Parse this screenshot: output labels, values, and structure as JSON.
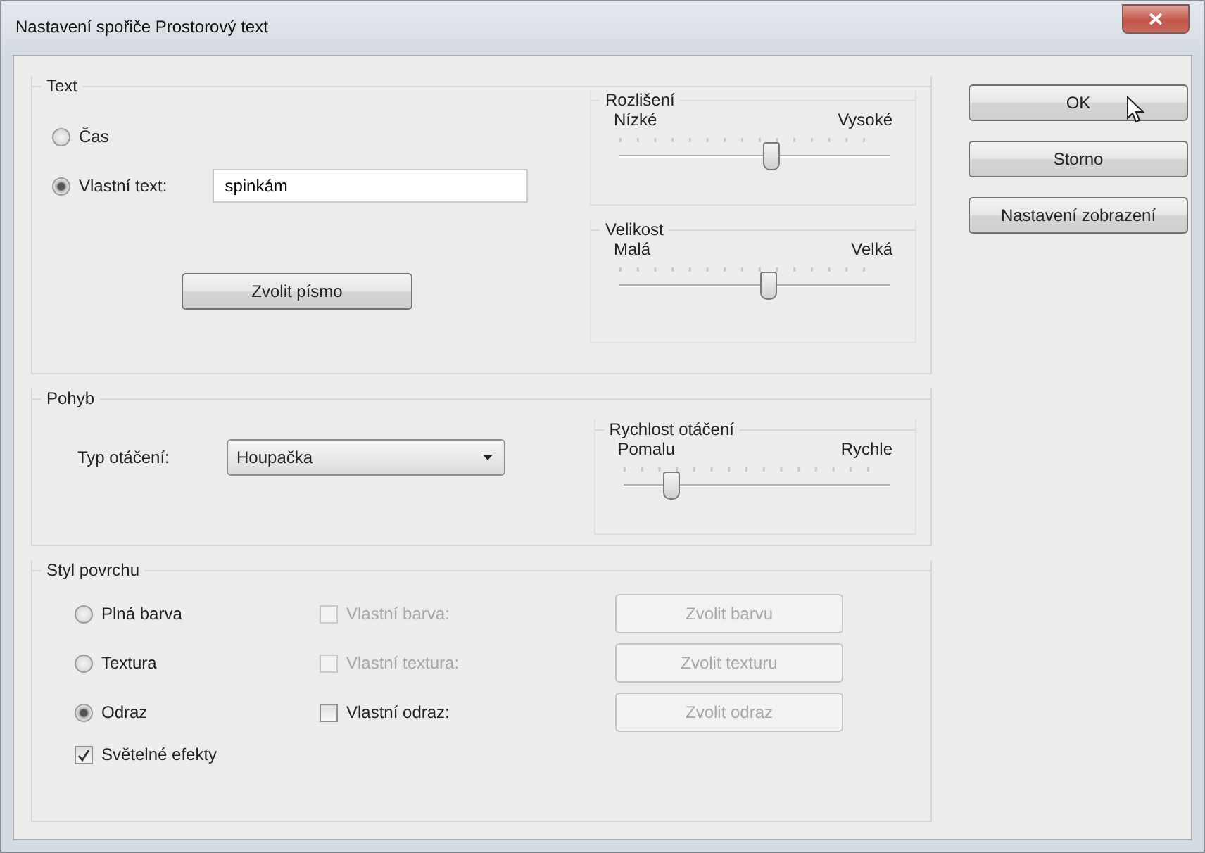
{
  "window": {
    "title": "Nastavení spořiče Prostorový text"
  },
  "text_group": {
    "title": "Text",
    "options": [
      {
        "label": "Čas",
        "selected": false
      },
      {
        "label": "Vlastní text:",
        "selected": true
      }
    ],
    "custom_text": {
      "value": "spinkám"
    },
    "font_button": "Zvolit písmo",
    "sliders": [
      {
        "title": "Rozlišení",
        "min_label": "Nízké",
        "max_label": "Vysoké",
        "level": 0.56
      },
      {
        "title": "Velikost",
        "min_label": "Malá",
        "max_label": "Velká",
        "level": 0.55
      }
    ]
  },
  "motion_group": {
    "title": "Pohyb",
    "rotation_label": "Typ otáčení:",
    "rotation_value": "Houpačka",
    "slider": {
      "title": "Rychlost otáčení",
      "min_label": "Pomalu",
      "max_label": "Rychle",
      "level": 0.18
    }
  },
  "surface_group": {
    "title": "Styl povrchu",
    "rows": [
      {
        "option": {
          "label": "Plná barva",
          "selected": false
        },
        "custom": {
          "label": "Vlastní barva:",
          "checked": false,
          "disabled": true
        },
        "button": {
          "label": "Zvolit barvu",
          "disabled": true
        }
      },
      {
        "option": {
          "label": "Textura",
          "selected": false
        },
        "custom": {
          "label": "Vlastní textura:",
          "checked": false,
          "disabled": true
        },
        "button": {
          "label": "Zvolit texturu",
          "disabled": true
        }
      },
      {
        "option": {
          "label": "Odraz",
          "selected": true
        },
        "custom": {
          "label": "Vlastní odraz:",
          "checked": false,
          "disabled": false
        },
        "button": {
          "label": "Zvolit odraz",
          "disabled": true
        }
      }
    ],
    "lighting": {
      "label": "Světelné efekty",
      "checked": true
    }
  },
  "buttons": [
    {
      "label": "OK"
    },
    {
      "label": "Storno"
    },
    {
      "label": "Nastavení zobrazení"
    }
  ]
}
